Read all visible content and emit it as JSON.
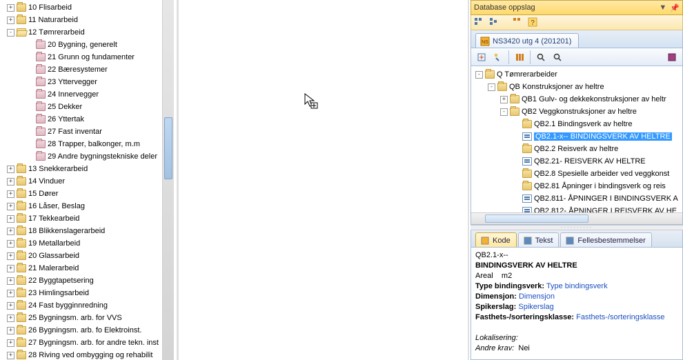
{
  "left_tree": [
    {
      "depth": 0,
      "toggle": "+",
      "icon": "closed",
      "label": "10 Flisarbeid"
    },
    {
      "depth": 0,
      "toggle": "+",
      "icon": "closed",
      "label": "11 Naturarbeid"
    },
    {
      "depth": 0,
      "toggle": "-",
      "icon": "open",
      "label": "12 Tømrerarbeid"
    },
    {
      "depth": 1,
      "toggle": "",
      "icon": "off",
      "label": "20 Bygning, generelt"
    },
    {
      "depth": 1,
      "toggle": "",
      "icon": "off",
      "label": "21 Grunn og fundamenter"
    },
    {
      "depth": 1,
      "toggle": "",
      "icon": "off",
      "label": "22 Bæresystemer"
    },
    {
      "depth": 1,
      "toggle": "",
      "icon": "off",
      "label": "23 Yttervegger"
    },
    {
      "depth": 1,
      "toggle": "",
      "icon": "off",
      "label": "24 Innervegger"
    },
    {
      "depth": 1,
      "toggle": "",
      "icon": "off",
      "label": "25 Dekker"
    },
    {
      "depth": 1,
      "toggle": "",
      "icon": "off",
      "label": "26 Yttertak"
    },
    {
      "depth": 1,
      "toggle": "",
      "icon": "off",
      "label": "27 Fast inventar"
    },
    {
      "depth": 1,
      "toggle": "",
      "icon": "off",
      "label": "28 Trapper, balkonger, m.m"
    },
    {
      "depth": 1,
      "toggle": "",
      "icon": "off",
      "label": "29 Andre bygningstekniske deler"
    },
    {
      "depth": 0,
      "toggle": "+",
      "icon": "closed",
      "label": "13 Snekkerarbeid"
    },
    {
      "depth": 0,
      "toggle": "+",
      "icon": "closed",
      "label": "14 Vinduer"
    },
    {
      "depth": 0,
      "toggle": "+",
      "icon": "closed",
      "label": "15 Dører"
    },
    {
      "depth": 0,
      "toggle": "+",
      "icon": "closed",
      "label": "16 Låser, Beslag"
    },
    {
      "depth": 0,
      "toggle": "+",
      "icon": "closed",
      "label": "17 Tekkearbeid"
    },
    {
      "depth": 0,
      "toggle": "+",
      "icon": "closed",
      "label": "18 Blikkenslagerarbeid"
    },
    {
      "depth": 0,
      "toggle": "+",
      "icon": "closed",
      "label": "19 Metallarbeid"
    },
    {
      "depth": 0,
      "toggle": "+",
      "icon": "closed",
      "label": "20 Glassarbeid"
    },
    {
      "depth": 0,
      "toggle": "+",
      "icon": "closed",
      "label": "21 Malerarbeid"
    },
    {
      "depth": 0,
      "toggle": "+",
      "icon": "closed",
      "label": "22 Byggtapetsering"
    },
    {
      "depth": 0,
      "toggle": "+",
      "icon": "closed",
      "label": "23 Himlingsarbeid"
    },
    {
      "depth": 0,
      "toggle": "+",
      "icon": "closed",
      "label": "24 Fast bygginnredning"
    },
    {
      "depth": 0,
      "toggle": "+",
      "icon": "closed",
      "label": "25 Bygningsm. arb. for VVS"
    },
    {
      "depth": 0,
      "toggle": "+",
      "icon": "closed",
      "label": "26 Bygningsm. arb. fo Elektroinst."
    },
    {
      "depth": 0,
      "toggle": "+",
      "icon": "closed",
      "label": "27 Bygningsm. arb. for andre tekn. inst"
    },
    {
      "depth": 0,
      "toggle": "+",
      "icon": "closed",
      "label": "28 Riving ved ombygging og rehabilit"
    }
  ],
  "db_panel": {
    "title": "Database oppslag",
    "tab_label": "NS3420 utg 4 (201201)",
    "tree": [
      {
        "depth": 0,
        "toggle": "-",
        "icon": "closed",
        "label": "Q Tømrerarbeider",
        "sel": false
      },
      {
        "depth": 1,
        "toggle": "-",
        "icon": "closed",
        "label": "QB Konstruksjoner av heltre",
        "sel": false
      },
      {
        "depth": 2,
        "toggle": "+",
        "icon": "closed",
        "label": "QB1 Gulv- og dekkekonstruksjoner av heltr",
        "sel": false
      },
      {
        "depth": 2,
        "toggle": "-",
        "icon": "closed",
        "label": "QB2 Veggkonstruksjoner av heltre",
        "sel": false
      },
      {
        "depth": 3,
        "toggle": "",
        "icon": "closed",
        "label": "QB2.1 Bindingsverk av heltre",
        "sel": false
      },
      {
        "depth": 3,
        "toggle": "",
        "icon": "doc",
        "label": "QB2.1-x-- BINDINGSVERK AV HELTRE",
        "sel": true
      },
      {
        "depth": 3,
        "toggle": "",
        "icon": "closed",
        "label": "QB2.2 Reisverk av heltre",
        "sel": false
      },
      {
        "depth": 3,
        "toggle": "",
        "icon": "doc",
        "label": "QB2.21- REISVERK AV HELTRE",
        "sel": false
      },
      {
        "depth": 3,
        "toggle": "",
        "icon": "closed",
        "label": "QB2.8 Spesielle arbeider ved veggkonst",
        "sel": false
      },
      {
        "depth": 3,
        "toggle": "",
        "icon": "closed",
        "label": "QB2.81 Åpninger i bindingsverk og reis",
        "sel": false
      },
      {
        "depth": 3,
        "toggle": "",
        "icon": "doc",
        "label": "QB2.811- ÅPNINGER I BINDINGSVERK A",
        "sel": false
      },
      {
        "depth": 3,
        "toggle": "",
        "icon": "doc",
        "label": "QB2.812- ÅPNINGER I REISVERK AV HE",
        "sel": false
      }
    ]
  },
  "detail": {
    "tabs": [
      "Kode",
      "Tekst",
      "Fellesbestemmelser"
    ],
    "code": "QB2.1-x--",
    "title": "BINDINGSVERK AV HELTRE",
    "areal_label": "Areal",
    "areal_unit": "m2",
    "rows": [
      {
        "k": "Type bindingsverk:",
        "v": "Type bindingsverk"
      },
      {
        "k": "Dimensjon:",
        "v": "Dimensjon"
      },
      {
        "k": "Spikerslag:",
        "v": "Spikerslag"
      },
      {
        "k": "Fasthets-/sorteringsklasse:",
        "v": "Fasthets-/sorteringsklasse"
      }
    ],
    "lokal": "Lokalisering:",
    "andre_k": "Andre krav:",
    "andre_v": "Nei"
  }
}
